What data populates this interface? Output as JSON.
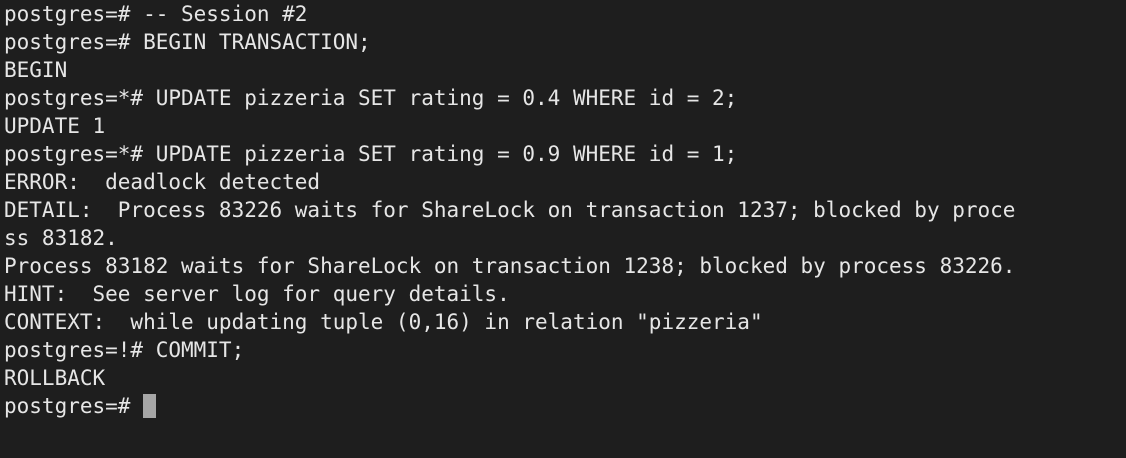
{
  "terminal": {
    "lines": [
      {
        "text": "postgres=# -- Session #2",
        "marker": false
      },
      {
        "text": "postgres=# BEGIN TRANSACTION;",
        "marker": true
      },
      {
        "text": "BEGIN",
        "marker": false
      },
      {
        "text": "postgres=*# UPDATE pizzeria SET rating = 0.4 WHERE id = 2;",
        "marker": true
      },
      {
        "text": "UPDATE 1",
        "marker": false
      },
      {
        "text": "postgres=*# UPDATE pizzeria SET rating = 0.9 WHERE id = 1;",
        "marker": true
      },
      {
        "text": "ERROR:  deadlock detected",
        "marker": false
      },
      {
        "text": "DETAIL:  Process 83226 waits for ShareLock on transaction 1237; blocked by proce",
        "marker": false
      },
      {
        "text": "ss 83182.",
        "marker": false
      },
      {
        "text": "Process 83182 waits for ShareLock on transaction 1238; blocked by process 83226.",
        "marker": false
      },
      {
        "text": "HINT:  See server log for query details.",
        "marker": false
      },
      {
        "text": "CONTEXT:  while updating tuple (0,16) in relation \"pizzeria\"",
        "marker": false
      },
      {
        "text": "postgres=!# COMMIT;",
        "marker": true
      },
      {
        "text": "ROLLBACK",
        "marker": false
      }
    ],
    "current_prompt": "postgres=# ",
    "colors": {
      "background": "#1e1e1e",
      "foreground": "#e6e6e6",
      "cursor": "#a6a6a6"
    }
  }
}
